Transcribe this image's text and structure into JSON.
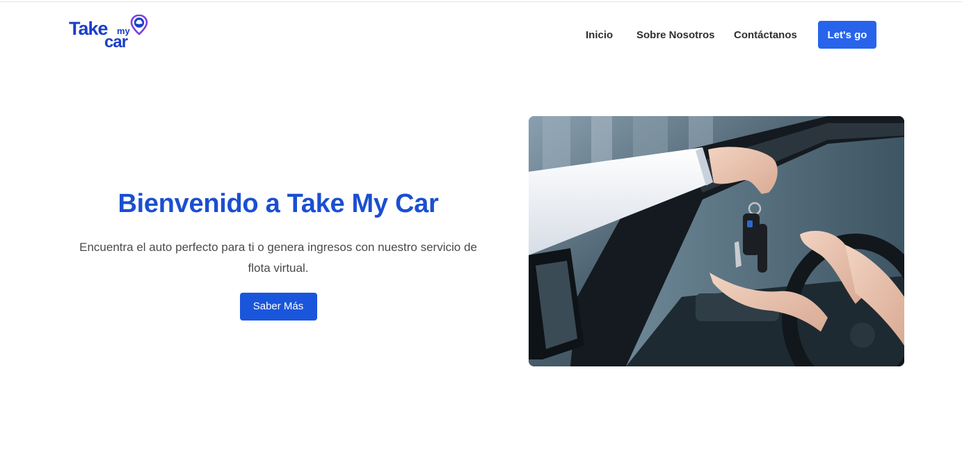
{
  "brand": {
    "logo_take": "Take",
    "logo_my": "my",
    "logo_car": "car",
    "primary_color": "#1a3fc9",
    "accent_color": "#2764eb",
    "pin_color": "#7b3fe4"
  },
  "nav": {
    "items": [
      {
        "label": "Inicio"
      },
      {
        "label": "Sobre Nosotros"
      },
      {
        "label": "Contáctanos"
      }
    ],
    "cta_label": "Let's go"
  },
  "hero": {
    "title": "Bienvenido a Take My Car",
    "subtitle": "Encuentra el auto perfecto para ti o genera ingresos con nuestro servicio de flota virtual.",
    "button_label": "Saber Más",
    "image_icon": "car-keys-handover-photo"
  }
}
